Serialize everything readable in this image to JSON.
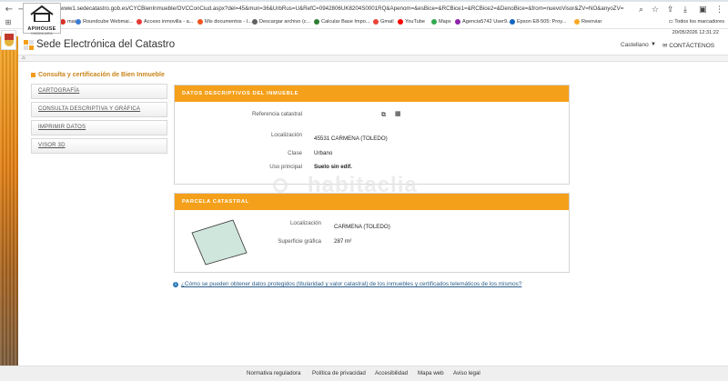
{
  "browser": {
    "url": "www1.sedecatastro.gob.es/CYCBienInmueble/OVCConCiud.aspx?del=45&mun=36&UrbRus=U&RefC=0942806UK8204S0001RQ&Apenom=&esBice=&RCBice1=&RCBice2=&DenoBice=&from=nuevoVisor&ZV=NO&anyoZV=",
    "bookmarks": [
      {
        "label": "mai...",
        "color": "#d93025"
      },
      {
        "label": "Roundcube Webmai...",
        "color": "#3a7bd5"
      },
      {
        "label": "Acceso inmovilla - a...",
        "color": "#e53935"
      },
      {
        "label": "Mis documentos - I...",
        "color": "#f4511e"
      },
      {
        "label": "Descargar archivo (c...",
        "color": "#616161"
      },
      {
        "label": "Calcular Base Impo...",
        "color": "#2e7d32"
      },
      {
        "label": "Gmail",
        "color": "#ea4335"
      },
      {
        "label": "YouTube",
        "color": "#ff0000"
      },
      {
        "label": "Maps",
        "color": "#34a853"
      },
      {
        "label": "Agencia5742 User9...",
        "color": "#8e24aa"
      },
      {
        "label": "Epson E8-505: Proy...",
        "color": "#1565c0"
      },
      {
        "label": "Reenviar",
        "color": "#f9a825"
      }
    ],
    "all_bookmarks": "Todos los marcadores",
    "clock": "20/05/2026  12:31:22"
  },
  "logo": {
    "name": "APIHOUSE",
    "sub": "INMOBILIARIA"
  },
  "header": {
    "site_title": "Sede Electrónica del Catastro",
    "language": "Castellano",
    "contact": "CONTÁCTENOS"
  },
  "section": {
    "title": "Consulta y certificación de Bien Inmueble"
  },
  "menu": [
    {
      "label": "CARTOGRAFÍA"
    },
    {
      "label": "CONSULTA DESCRIPTIVA Y GRÁFICA"
    },
    {
      "label": "IMPRIMIR DATOS"
    },
    {
      "label": "VISOR 3D"
    }
  ],
  "descriptive": {
    "header": "DATOS DESCRIPTIVOS DEL INMUEBLE",
    "ref_label": "Referencia catastral",
    "loc_label": "Localización",
    "loc_value": "45531 CARMENA (TOLEDO)",
    "class_label": "Clase",
    "class_value": "Urbano",
    "use_label": "Uso principal",
    "use_value": "Suelo sin edif."
  },
  "parcel": {
    "header": "PARCELA CATASTRAL",
    "loc_label": "Localización",
    "loc_value": "CARMENA (TOLEDO)",
    "area_label": "Superficie gráfica",
    "area_value": "287 m²"
  },
  "watermark": "habitaclia",
  "info_link": "¿Cómo se pueden obtener datos protegidos (titularidad y valor catastral) de los inmuebles y certificados telemáticos de los mismos?",
  "footer": [
    {
      "label": "Normativa reguladora"
    },
    {
      "label": "Política de privacidad"
    },
    {
      "label": "Accesibilidad"
    },
    {
      "label": "Mapa web"
    },
    {
      "label": "Aviso legal"
    }
  ],
  "colors": {
    "accent": "#f5a01a",
    "parcel_fill": "#cfe6dc"
  }
}
